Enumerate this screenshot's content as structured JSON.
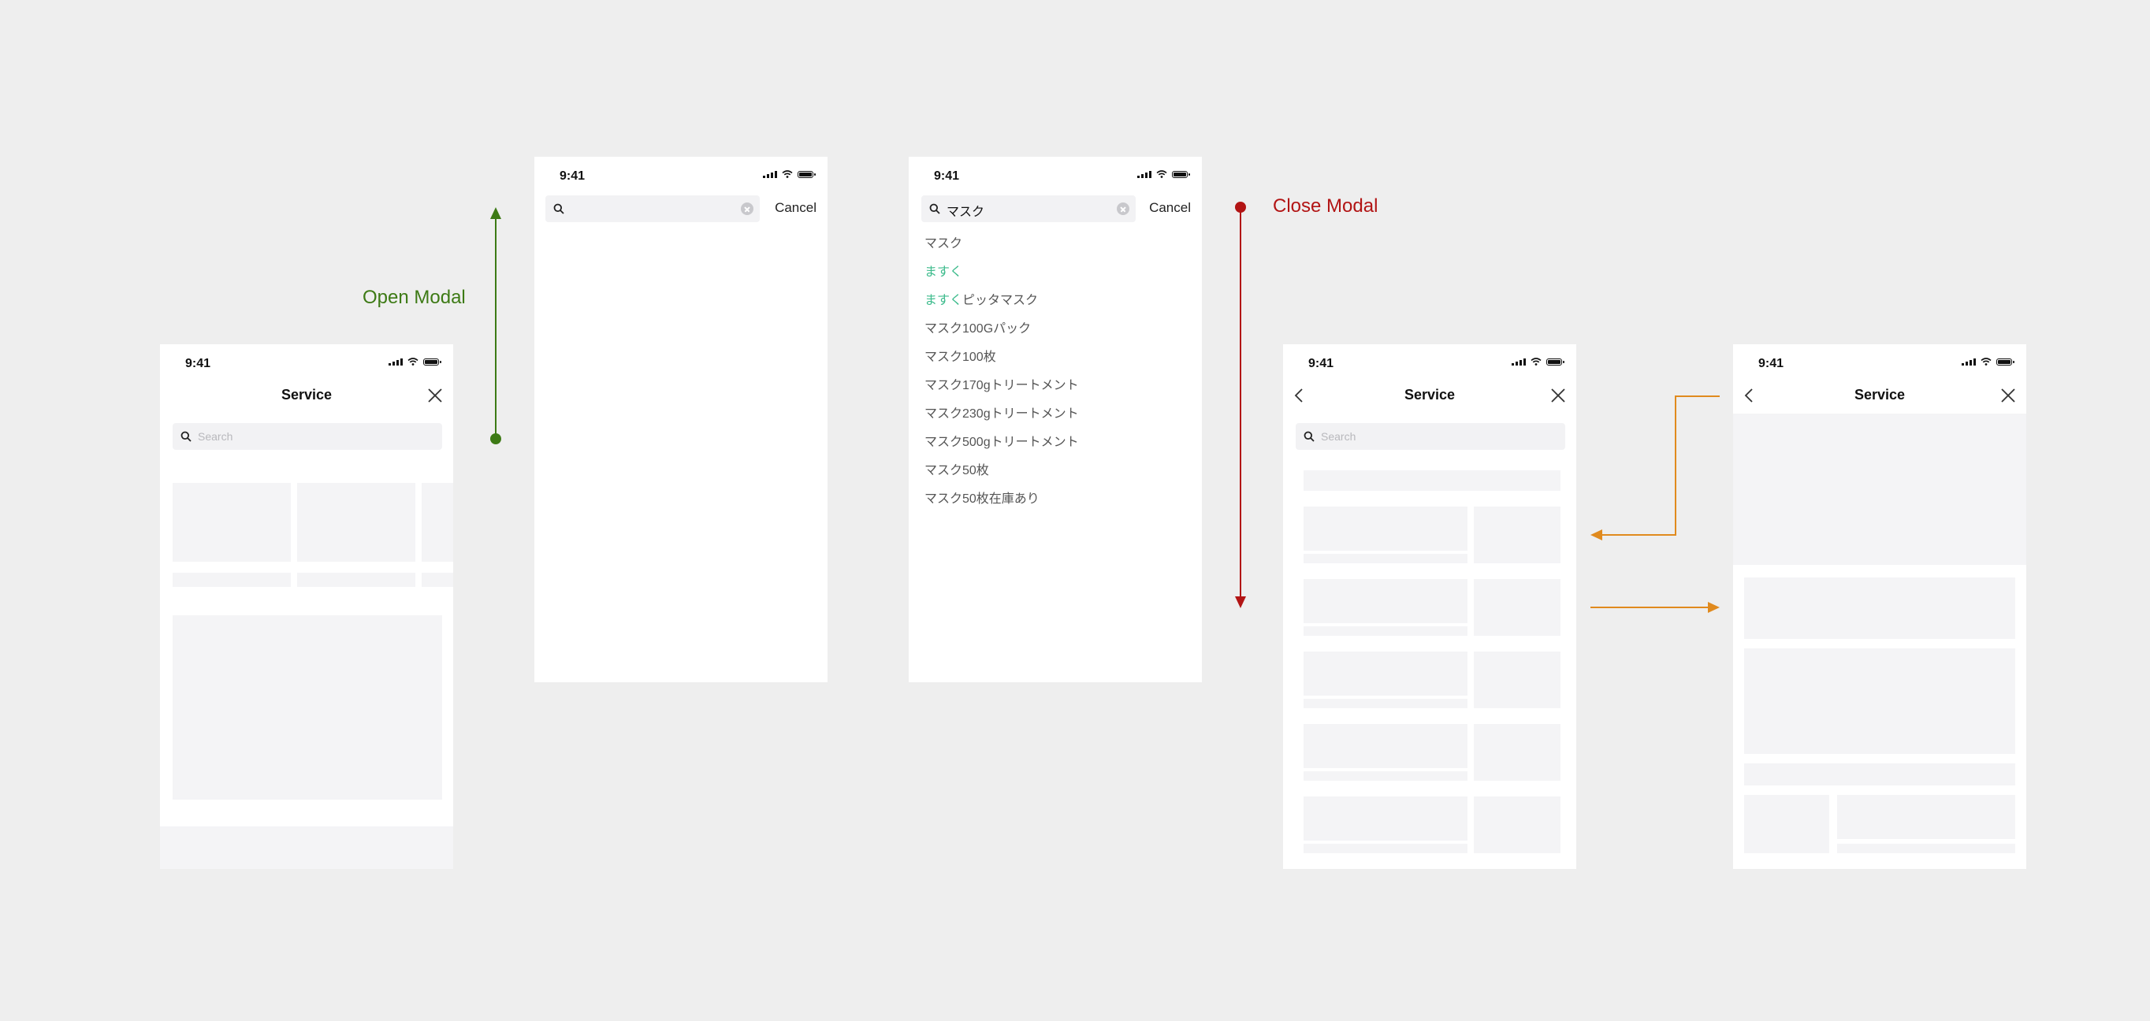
{
  "status_time": "9:41",
  "service_title": "Service",
  "search_placeholder": "Search",
  "cancel_label": "Cancel",
  "search_query": "マスク",
  "suggestions": [
    {
      "highlight": "",
      "text": "マスク"
    },
    {
      "highlight": "ますく",
      "text": ""
    },
    {
      "highlight": "ますく",
      "text": "ピッタマスク"
    },
    {
      "highlight": "",
      "text": "マスク100Gパック"
    },
    {
      "highlight": "",
      "text": "マスク100枚"
    },
    {
      "highlight": "",
      "text": "マスク170gトリートメント"
    },
    {
      "highlight": "",
      "text": "マスク230gトリートメント"
    },
    {
      "highlight": "",
      "text": "マスク500gトリートメント"
    },
    {
      "highlight": "",
      "text": "マスク50枚"
    },
    {
      "highlight": "",
      "text": "マスク50枚在庫あり"
    }
  ],
  "labels": {
    "open_modal": "Open Modal",
    "close_modal": "Close Modal"
  },
  "colors": {
    "open_arrow": "#3d7a15",
    "close_arrow": "#b21414",
    "flow_arrow": "#e08a1e",
    "highlight": "#3dbb8c"
  },
  "icons": [
    "close-icon",
    "back-icon",
    "search-icon",
    "clear-icon",
    "signal-icon",
    "wifi-icon",
    "battery-icon"
  ]
}
